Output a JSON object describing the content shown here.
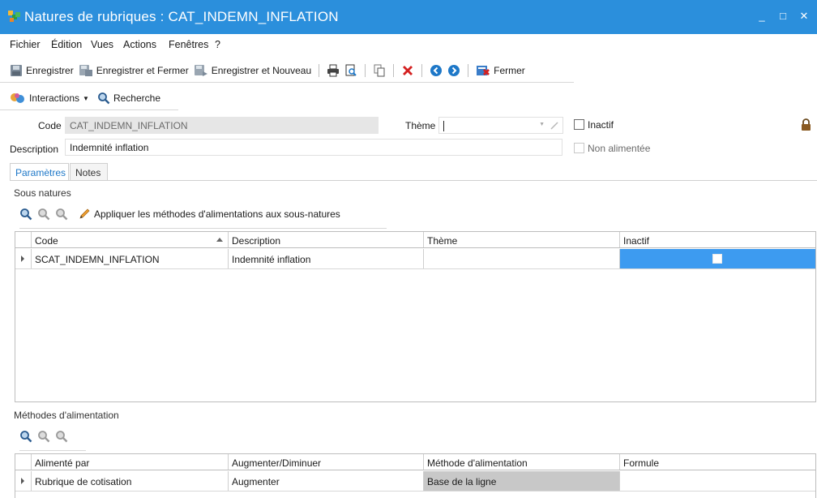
{
  "window": {
    "title": "Natures de rubriques : CAT_INDEMN_INFLATION",
    "minimize": "_",
    "maximize": "□",
    "close": "✕"
  },
  "menu": {
    "items": [
      "Fichier",
      "Édition",
      "Vues",
      "Actions",
      "Fenêtres",
      "?"
    ]
  },
  "toolbar": {
    "save_label": "Enregistrer",
    "save_close_label": "Enregistrer et Fermer",
    "save_new_label": "Enregistrer et Nouveau",
    "close_label": "Fermer"
  },
  "toolbar2": {
    "interactions_label": "Interactions",
    "search_label": "Recherche"
  },
  "form": {
    "code_label": "Code",
    "code_value": "CAT_INDEMN_INFLATION",
    "theme_label": "Thème",
    "theme_value": "",
    "inactif_label": "Inactif",
    "description_label": "Description",
    "description_value": "Indemnité inflation",
    "non_alimentee_label": "Non alimentée"
  },
  "tabs": [
    {
      "label": "Paramètres",
      "active": true
    },
    {
      "label": "Notes",
      "active": false
    }
  ],
  "sous_natures": {
    "title": "Sous natures",
    "apply_label": "Appliquer les méthodes d'alimentations aux sous-natures",
    "columns": [
      "Code",
      "Description",
      "Thème",
      "Inactif"
    ],
    "rows": [
      {
        "code": "SCAT_INDEMN_INFLATION",
        "description": "Indemnité inflation",
        "theme": "",
        "inactif": false
      }
    ]
  },
  "methodes": {
    "title": "Méthodes d'alimentation",
    "columns": [
      "Alimenté par",
      "Augmenter/Diminuer",
      "Méthode d'alimentation",
      "Formule"
    ],
    "rows": [
      {
        "alimente_par": "Rubrique de cotisation",
        "augmenter_diminuer": "Augmenter",
        "methode": "Base de la ligne",
        "formule": ""
      }
    ]
  },
  "colors": {
    "titlebar": "#2b8fdc",
    "selection": "#3d9bf0",
    "readonly_cell": "#c8c8c8",
    "delete_red": "#d42020"
  }
}
